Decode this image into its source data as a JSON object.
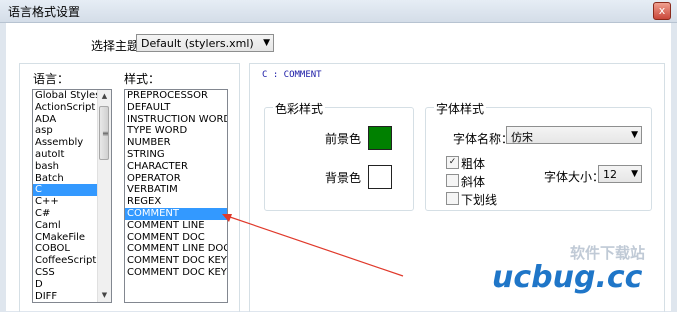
{
  "window": {
    "title": "语言格式设置",
    "close_glyph": "x"
  },
  "theme": {
    "label": "选择主题",
    "selected": "Default (stylers.xml)"
  },
  "language": {
    "label": "语言：",
    "items": [
      "Global Styles",
      "ActionScript",
      "ADA",
      "asp",
      "Assembly",
      "autoIt",
      "bash",
      "Batch",
      "C",
      "C++",
      "C#",
      "Caml",
      "CMakeFile",
      "COBOL",
      "CoffeeScript",
      "CSS",
      "D",
      "DIFF"
    ],
    "selected_index": 8
  },
  "style": {
    "label": "样式：",
    "items": [
      "PREPROCESSOR",
      "DEFAULT",
      "INSTRUCTION WORD",
      "TYPE WORD",
      "NUMBER",
      "STRING",
      "CHARACTER",
      "OPERATOR",
      "VERBATIM",
      "REGEX",
      "COMMENT",
      "COMMENT LINE",
      "COMMENT DOC",
      "COMMENT LINE DOC",
      "COMMENT DOC KEYWORD",
      "COMMENT DOC KEYWORD ERROR"
    ],
    "selected_index": 10
  },
  "panel": {
    "heading": "C : COMMENT"
  },
  "colors": {
    "group_label": "色彩样式",
    "foreground_label": "前景色",
    "background_label": "背景色",
    "foreground": "#008000",
    "background": "#ffffff"
  },
  "font": {
    "group_label": "字体样式",
    "name_label": "字体名称：",
    "name_value": "仿宋",
    "bold_label": "粗体",
    "bold_checked": true,
    "italic_label": "斜体",
    "italic_checked": false,
    "underline_label": "下划线",
    "underline_checked": false,
    "size_label": "字体大小：",
    "size_value": "12"
  },
  "watermark": {
    "top": "软件下载站",
    "bottom": "ucbug.cc"
  },
  "accent": {
    "arrow": "#e0392b",
    "selection": "#3399ff"
  }
}
